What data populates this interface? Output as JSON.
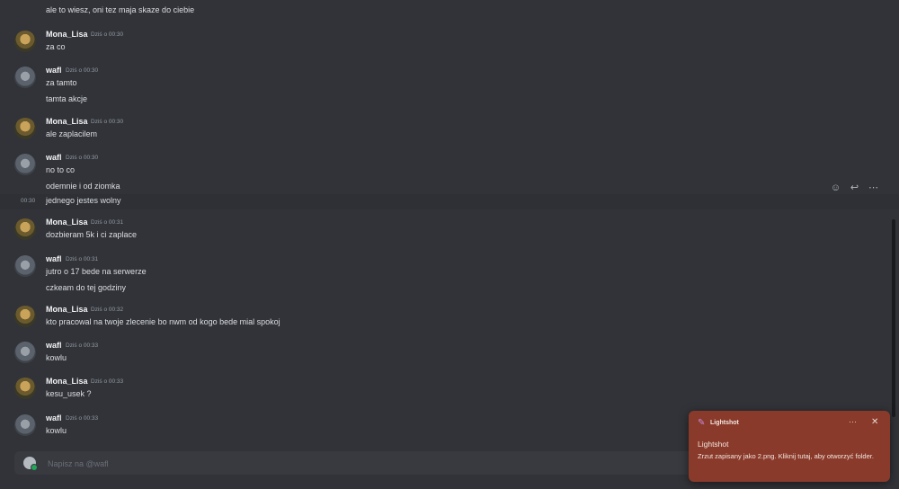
{
  "messages": [
    {
      "type": "cont",
      "text": "ale to wiesz, oni tez maja skaze do ciebie"
    },
    {
      "type": "head",
      "author": "Mona_Lisa",
      "avatar": "mona",
      "time": "Dziś o 00:30",
      "text": "za co"
    },
    {
      "type": "head",
      "author": "wafl",
      "avatar": "wafl",
      "time": "Dziś o 00:30",
      "text": "za tamto"
    },
    {
      "type": "cont",
      "text": "tamta akcje"
    },
    {
      "type": "head",
      "author": "Mona_Lisa",
      "avatar": "mona",
      "time": "Dziś o 00:30",
      "text": "ale zaplacilem"
    },
    {
      "type": "head",
      "author": "wafl",
      "avatar": "wafl",
      "time": "Dziś o 00:30",
      "text": "no to co"
    },
    {
      "type": "cont",
      "text": "odemnie i od ziomka"
    },
    {
      "type": "cont",
      "text": "jednego jestes wolny",
      "side_time": "00:30",
      "hover": true
    },
    {
      "type": "head",
      "author": "Mona_Lisa",
      "avatar": "mona",
      "time": "Dziś o 00:31",
      "text": "dozbieram 5k i ci zaplace"
    },
    {
      "type": "head",
      "author": "wafl",
      "avatar": "wafl",
      "time": "Dziś o 00:31",
      "text": "jutro o 17 bede na serwerze"
    },
    {
      "type": "cont",
      "text": "czkeam do tej godziny"
    },
    {
      "type": "head",
      "author": "Mona_Lisa",
      "avatar": "mona",
      "time": "Dziś o 00:32",
      "text": "kto pracowal na twoje zlecenie bo nwm od kogo bede mial spokoj"
    },
    {
      "type": "head",
      "author": "wafl",
      "avatar": "wafl",
      "time": "Dziś o 00:33",
      "text": "kowlu"
    },
    {
      "type": "head",
      "author": "Mona_Lisa",
      "avatar": "mona",
      "time": "Dziś o 00:33",
      "text": "kesu_usek ?"
    },
    {
      "type": "head",
      "author": "wafl",
      "avatar": "wafl",
      "time": "Dziś o 00:33",
      "text": "kowlu"
    }
  ],
  "hover_actions": [
    "add-reaction-icon",
    "reply-icon",
    "more-icon"
  ],
  "composer": {
    "placeholder": "Napisz na @wafl"
  },
  "toast": {
    "app": "Lightshot",
    "title": "Lightshot",
    "body": "Zrzut zapisany jako 2.png. Kliknij tutaj, aby otworzyć folder.",
    "more": "···",
    "close": "✕"
  },
  "colors": {
    "background": "#313338",
    "toast": "#8a3a2a",
    "online": "#23a55a"
  }
}
